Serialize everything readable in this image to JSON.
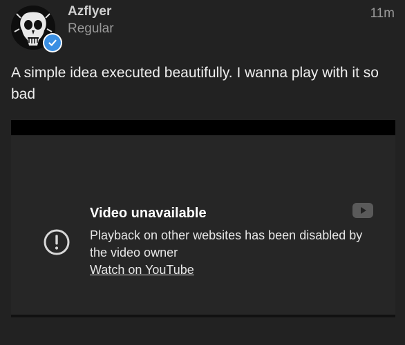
{
  "post": {
    "username": "Azflyer",
    "user_title": "Regular",
    "time": "11m",
    "body": "A simple idea executed beautifully. I wanna play with it so bad"
  },
  "embed": {
    "title": "Video unavailable",
    "message": "Playback on other websites has been disabled by the video owner",
    "link": "Watch on YouTube"
  },
  "icons": {
    "avatar": "skull-avatar",
    "badge": "verified-check-icon",
    "alert": "alert-circle-icon",
    "youtube": "youtube-logo-icon"
  },
  "colors": {
    "background": "#222222",
    "verified": "#3a8fe3",
    "embed_background": "#262626"
  }
}
